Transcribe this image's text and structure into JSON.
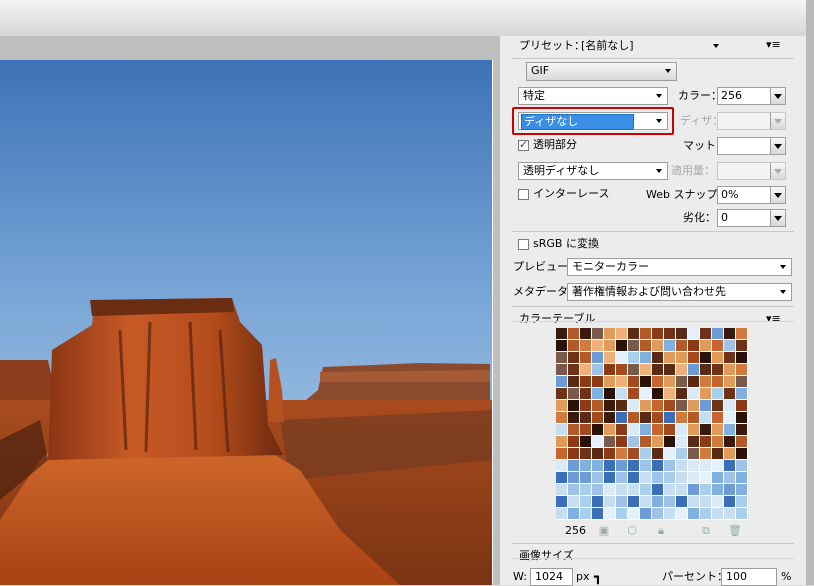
{
  "preset": {
    "label": "プリセット：",
    "value": "[名前なし]"
  },
  "format": "GIF",
  "reduction": "特定",
  "dither_algo": "ディザなし",
  "transparency_dither": "透明ディザなし",
  "colors": {
    "label": "カラー：",
    "value": "256"
  },
  "dither": {
    "label": "ディザ：",
    "value": ""
  },
  "transparency": {
    "label": "透明部分",
    "checked": true
  },
  "matte": {
    "label": "マット：",
    "value": ""
  },
  "amount": {
    "label": "適用量：",
    "value": ""
  },
  "interlace": {
    "label": "インターレース",
    "checked": false
  },
  "web_snap": {
    "label": "Web スナップ：",
    "value": "0%"
  },
  "lossy": {
    "label": "劣化：",
    "value": "0"
  },
  "srgb": {
    "label": "sRGB に変換",
    "checked": false
  },
  "preview": {
    "label": "プレビュー：",
    "value": "モニターカラー"
  },
  "metadata": {
    "label": "メタデータ：",
    "value": "著作権情報および問い合わせ先"
  },
  "color_table": {
    "title": "カラーテーブル",
    "count": "256"
  },
  "image_size": {
    "title": "画像サイズ",
    "w_label": "W:",
    "w_value": "1024",
    "w_unit": "px",
    "percent_label": "パーセント：",
    "percent_value": "100",
    "percent_unit": "%"
  },
  "colors_palette": {
    "highlight": "#cc0000",
    "selection": "#3a8ee6"
  },
  "icons": [
    "menu-icon",
    "new-color-icon",
    "web-shift-icon",
    "cube-icon",
    "lock-icon",
    "add-icon",
    "trash-icon",
    "chain-link-icon"
  ]
}
